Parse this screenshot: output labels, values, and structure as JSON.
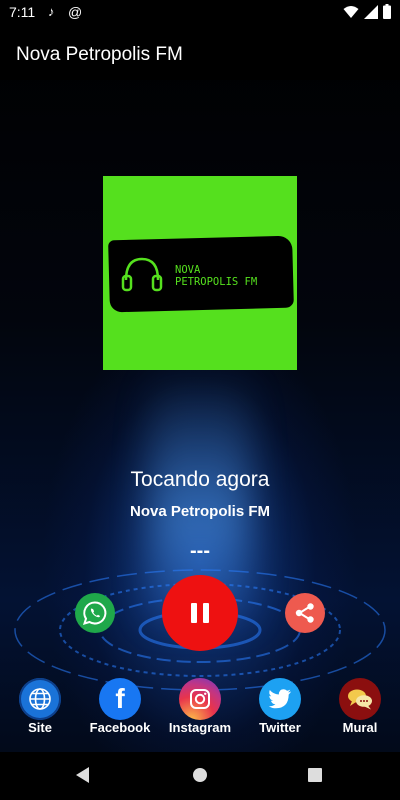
{
  "status_bar": {
    "time": "7:11",
    "icons": [
      "music-note-icon",
      "at-sign-icon",
      "wifi-icon",
      "signal-icon",
      "battery-icon"
    ]
  },
  "app_bar": {
    "title": "Nova Petropolis FM"
  },
  "logo": {
    "line1": "NOVA",
    "line2": "PETROPOLIS FM",
    "background": "#55e01e"
  },
  "player": {
    "now_playing_label": "Tocando agora",
    "station_name": "Nova Petropolis FM",
    "track": "---",
    "state": "playing"
  },
  "actions": {
    "whatsapp": {
      "icon": "whatsapp-icon",
      "color": "#1fa84a"
    },
    "pause": {
      "icon": "pause-icon",
      "color": "#ee1111"
    },
    "share": {
      "icon": "share-icon",
      "color": "#ee5a4f"
    }
  },
  "bottom_nav": [
    {
      "label": "Site",
      "icon": "globe-icon",
      "color": "#1a73d8"
    },
    {
      "label": "Facebook",
      "icon": "facebook-icon",
      "color": "#1877f2"
    },
    {
      "label": "Instagram",
      "icon": "instagram-icon",
      "color": "#c13584"
    },
    {
      "label": "Twitter",
      "icon": "twitter-icon",
      "color": "#1da1f2"
    },
    {
      "label": "Mural",
      "icon": "chat-bubbles-icon",
      "color": "#8b0f0f"
    }
  ],
  "system_nav": [
    "back-icon",
    "home-icon",
    "recents-icon"
  ]
}
